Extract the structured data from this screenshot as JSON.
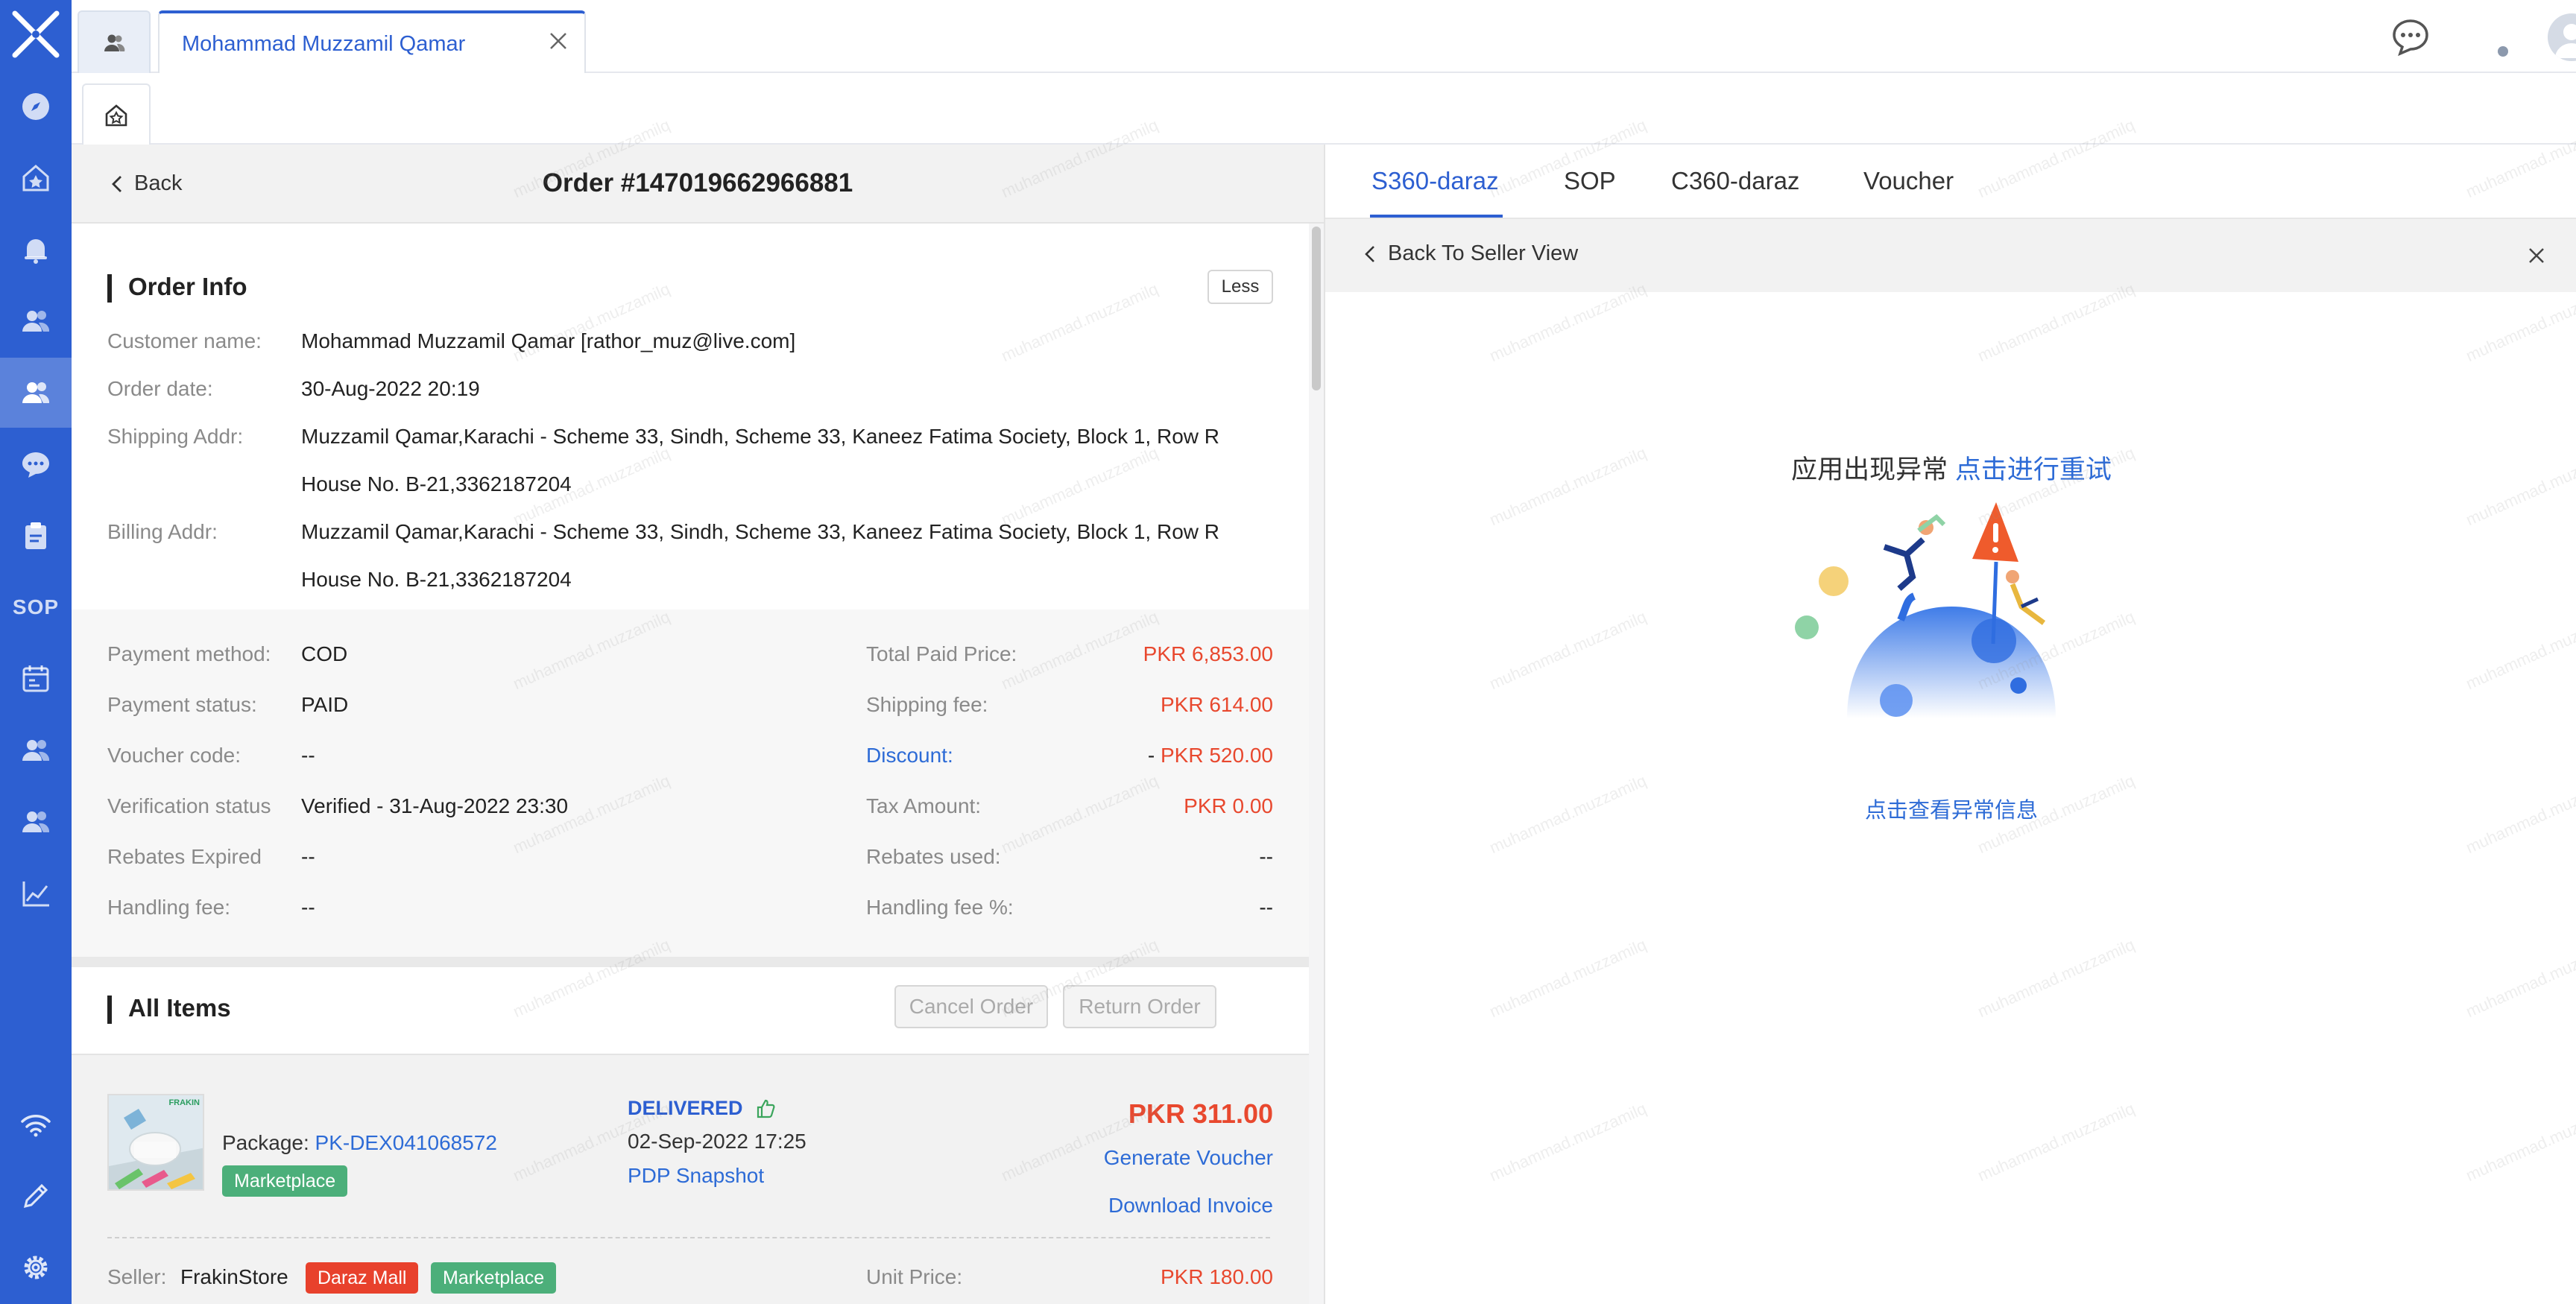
{
  "colors": {
    "brand": "#2d5fd1",
    "price_red": "#e8482e",
    "link_blue": "#2d6bd6",
    "tag_green": "#4caf7a",
    "tag_red": "#e8412c"
  },
  "sidebar": {
    "items": [
      {
        "icon": "compass-icon"
      },
      {
        "icon": "home-star-icon"
      },
      {
        "icon": "bell-icon"
      },
      {
        "icon": "users-icon"
      },
      {
        "icon": "user-active-icon"
      },
      {
        "icon": "chat-icon"
      },
      {
        "icon": "clipboard-icon"
      },
      {
        "label": "SOP"
      },
      {
        "icon": "calendar-icon"
      },
      {
        "icon": "customer-icon"
      },
      {
        "icon": "team-icon"
      },
      {
        "icon": "chart-icon"
      },
      {
        "icon": "wifi-icon"
      },
      {
        "icon": "pencil-icon"
      },
      {
        "icon": "gear-icon"
      }
    ]
  },
  "tabs": {
    "main_label": "Mohammad Muzzamil Qamar"
  },
  "order": {
    "back_label": "Back",
    "title": "Order #147019662966881",
    "info_title": "Order Info",
    "less_label": "Less",
    "customer_name_label": "Customer name:",
    "customer_name": "Mohammad Muzzamil Qamar [rathor_muz@live.com]",
    "order_date_label": "Order date:",
    "order_date": "30-Aug-2022 20:19",
    "shipping_label": "Shipping Addr:",
    "shipping_line1": "Muzzamil Qamar,Karachi - Scheme 33, Sindh, Scheme 33, Kaneez Fatima Society, Block 1, Row R",
    "shipping_line2": "House No. B-21,3362187204",
    "billing_label": "Billing Addr:",
    "billing_line1": "Muzzamil Qamar,Karachi - Scheme 33, Sindh, Scheme 33, Kaneez Fatima Society, Block 1, Row R",
    "billing_line2": "House No. B-21,3362187204"
  },
  "payment": {
    "method_label": "Payment method:",
    "method": "COD",
    "status_label": "Payment status:",
    "status": "PAID",
    "voucher_label": "Voucher code:",
    "voucher": "--",
    "verification_label": "Verification status",
    "verification": "Verified - 31-Aug-2022 23:30",
    "rebates_expired_label": "Rebates Expired",
    "rebates_expired": "--",
    "handling_fee_label": "Handling fee:",
    "handling_fee": "--",
    "total_paid_label": "Total Paid Price:",
    "total_paid": "PKR 6,853.00",
    "shipping_fee_label": "Shipping fee:",
    "shipping_fee": "PKR 614.00",
    "discount_label": "Discount:",
    "discount_prefix": "-",
    "discount": "PKR 520.00",
    "tax_label": "Tax Amount:",
    "tax": "PKR 0.00",
    "rebates_used_label": "Rebates used:",
    "rebates_used": "--",
    "handling_pct_label": "Handling fee %:",
    "handling_pct": "--"
  },
  "items": {
    "title": "All Items",
    "cancel_label": "Cancel Order",
    "return_label": "Return Order",
    "package_label": "Package:",
    "package_id": "PK-DEX041068572",
    "marketplace_tag": "Marketplace",
    "status": "DELIVERED",
    "status_date": "02-Sep-2022 17:25",
    "pdp_label": "PDP Snapshot",
    "price": "PKR 311.00",
    "generate_voucher": "Generate Voucher",
    "download_invoice": "Download Invoice",
    "seller_label": "Seller:",
    "seller_name": "FrakinStore",
    "daraz_mall_tag": "Daraz Mall",
    "unit_price_label": "Unit Price:",
    "unit_price": "PKR 180.00",
    "thumb_brand": "FRAKIN"
  },
  "right_panel": {
    "tabs": [
      "S360-daraz",
      "SOP",
      "C360-daraz",
      "Voucher"
    ],
    "back_to_seller": "Back To Seller View",
    "error_text": "应用出现异常",
    "retry_text": "点击进行重试",
    "error_info_link": "点击查看异常信息"
  },
  "watermark": "muhammad.muzzamilq"
}
